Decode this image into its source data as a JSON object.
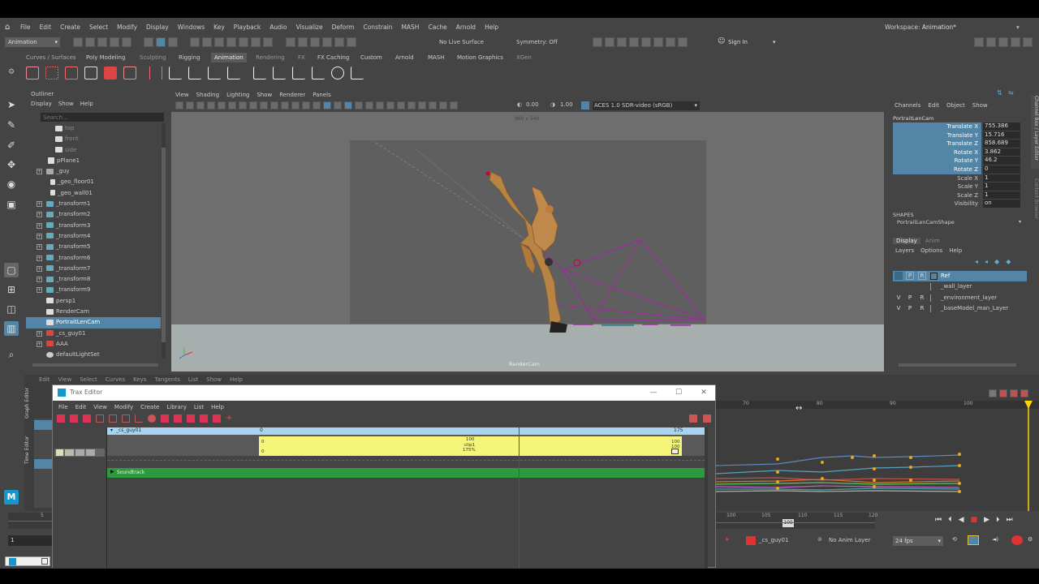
{
  "main_menu": [
    "File",
    "Edit",
    "Create",
    "Select",
    "Modify",
    "Display",
    "Windows",
    "Key",
    "Playback",
    "Audio",
    "Visualize",
    "Deform",
    "Constrain",
    "MASH",
    "Cache",
    "Arnold",
    "Help"
  ],
  "workspace": {
    "label": "Workspace:",
    "value": "Animation*"
  },
  "status_line": {
    "mode": "Animation",
    "live_surface": "No Live Surface",
    "symmetry": "Symmetry: Off",
    "sign_in": "Sign In"
  },
  "shelf_tabs": [
    "Curves / Surfaces",
    "Poly Modeling",
    "Sculpting",
    "Rigging",
    "Animation",
    "Rendering",
    "FX",
    "FX Caching",
    "Custom",
    "Arnold",
    "MASH",
    "Motion Graphics",
    "XGen"
  ],
  "shelf_active": "Animation",
  "outliner": {
    "title": "Outliner",
    "menu": [
      "Display",
      "Show",
      "Help"
    ],
    "search_placeholder": "Search...",
    "items": [
      "top",
      "front",
      "side",
      "pPlane1",
      "_guy",
      "_geo_floor01",
      "_geo_wall01",
      "_transform1",
      "_transform2",
      "_transform3",
      "_transform4",
      "_transform5",
      "_transform6",
      "_transform7",
      "_transform8",
      "_transform9",
      "persp1",
      "RenderCam",
      "PortraitLenCam",
      "_cs_guy01",
      "AAA",
      "defaultLightSet"
    ]
  },
  "viewport": {
    "menu": [
      "View",
      "Shading",
      "Lighting",
      "Show",
      "Renderer",
      "Panels"
    ],
    "exposure": "0.00",
    "gamma": "1.00",
    "color_space": "ACES 1.0 SDR-video (sRGB)",
    "resolution": "960 x 540",
    "camera_label": "RenderCam"
  },
  "channel_box": {
    "menu": [
      "Channels",
      "Edit",
      "Object",
      "Show"
    ],
    "object": "PortraitLenCam",
    "channels": [
      {
        "name": "Translate X",
        "value": "755.386"
      },
      {
        "name": "Translate Y",
        "value": "15.716"
      },
      {
        "name": "Translate Z",
        "value": "858.689"
      },
      {
        "name": "Rotate X",
        "value": "3.862"
      },
      {
        "name": "Rotate Y",
        "value": "46.2"
      },
      {
        "name": "Rotate Z",
        "value": "0"
      },
      {
        "name": "Scale X",
        "value": "1"
      },
      {
        "name": "Scale Y",
        "value": "1"
      },
      {
        "name": "Scale Z",
        "value": "1"
      },
      {
        "name": "Visibility",
        "value": "on"
      }
    ],
    "shapes_label": "SHAPES",
    "shape_name": "PortraitLenCamShape",
    "side_tabs": [
      "Channel Box / Layer Editor",
      "Content Browser"
    ]
  },
  "layer_editor": {
    "tabs": [
      "Display",
      "Anim"
    ],
    "menu": [
      "Layers",
      "Options",
      "Help"
    ],
    "layers": [
      {
        "v": "",
        "p": "P",
        "r": "R",
        "name": "Ref"
      },
      {
        "v": "",
        "p": "",
        "r": "",
        "name": "_wall_layer"
      },
      {
        "v": "V",
        "p": "P",
        "r": "R",
        "name": "_environment_layer"
      },
      {
        "v": "V",
        "p": "P",
        "r": "R",
        "name": "_baseModel_man_Layer"
      }
    ]
  },
  "graph_editor": {
    "menu": [
      "Edit",
      "View",
      "Select",
      "Curves",
      "Keys",
      "Tangents",
      "List",
      "Show",
      "Help"
    ],
    "side_tabs": [
      "Graph Editor",
      "Time Editor"
    ],
    "ruler": [
      "70",
      "80",
      "90",
      "100"
    ]
  },
  "trax_editor": {
    "title": "Trax Editor",
    "menu": [
      "File",
      "Edit",
      "View",
      "Modify",
      "Create",
      "Library",
      "List",
      "Help"
    ],
    "character": "_cs_guy01",
    "track_start": "0",
    "track_end": "175",
    "clip": {
      "start": "0",
      "start2": "0",
      "mid_frame": "100",
      "name": "clip1",
      "scale": "175%",
      "end": "100",
      "end2": "100"
    },
    "soundtrack": "Soundtrack"
  },
  "time_slider": {
    "ruler": [
      "100",
      "105",
      "110",
      "115",
      "120"
    ],
    "current": "100",
    "left_tick": "5"
  },
  "range": {
    "start": "1",
    "character": "_cs_guy01",
    "anim_layer": "No Anim Layer",
    "fps": "24 fps"
  },
  "colors": {
    "accent": "#5285a6",
    "clip": "#f5f57a",
    "soundtrack": "#2e9a3e",
    "playhead": "#cc2222",
    "trax_header": "#a9d4f0"
  }
}
